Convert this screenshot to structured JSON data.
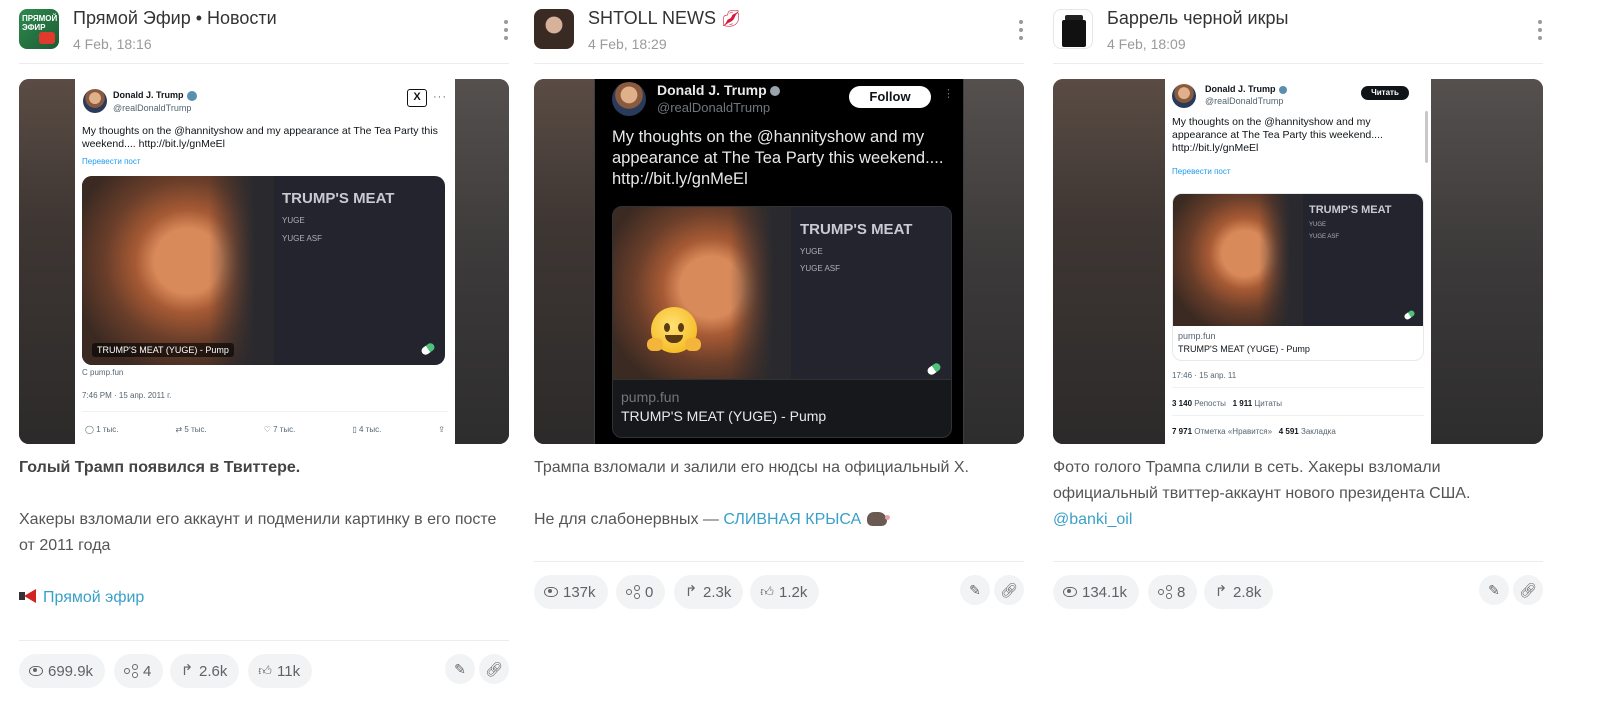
{
  "posts": [
    {
      "channel": "Прямой Эфир • Новости",
      "avatar_text": "ПРЯМОЙ ЭФИР",
      "date": "4 Feb, 18:16",
      "tweet": {
        "name": "Donald J. Trump",
        "handle": "@realDonaldTrump",
        "text": "My thoughts on the @hannityshow and my appearance at The Tea Party this weekend.... http://bit.ly/gnMeEl",
        "translate": "Перевести пост",
        "card_title": "TRUMP'S MEAT",
        "card_line1": "YUGE",
        "card_line2": "YUGE ASF",
        "image_caption": "TRUMP'S MEAT (YUGE) - Pump",
        "source": "С pump.fun",
        "timestamp": "7:46 PM · 15 апр. 2011 г.",
        "replies": "1 тыс.",
        "retweets": "5 тыс.",
        "likes": "7 тыс.",
        "bookmarks": "4 тыс."
      },
      "title": "Голый Трамп появился в Твиттере.",
      "body": "Хакеры взломали его аккаунт и подменили картинку в его посте от 2011 года",
      "signature": "Прямой эфир",
      "stats": {
        "views": "699.9k",
        "shares": "4",
        "forwards": "2.6k",
        "reactions": "11k"
      }
    },
    {
      "channel": "SHTOLL NEWS",
      "date": "4 Feb, 18:29",
      "tweet": {
        "name": "Donald J. Trump",
        "handle": "@realDonaldTrump",
        "follow": "Follow",
        "text": "My thoughts on the @hannityshow and my appearance at The Tea Party this weekend.... http://bit.ly/gnMeEl",
        "card_title": "TRUMP'S MEAT",
        "card_line1": "YUGE",
        "card_line2": "YUGE ASF",
        "link_domain": "pump.fun",
        "link_title": "TRUMP'S MEAT (YUGE) - Pump"
      },
      "body": "Трампа взломали и залили его нюдсы на официальный Х.",
      "footer_prefix": "Не для слабонервных — ",
      "footer_link": "СЛИВНАЯ КРЫСА",
      "stats": {
        "views": "137k",
        "shares": "0",
        "forwards": "2.3k",
        "reactions": "1.2k"
      }
    },
    {
      "channel": "Баррель черной икры",
      "date": "4 Feb, 18:09",
      "tweet": {
        "name": "Donald J. Trump",
        "handle": "@realDonaldTrump",
        "read": "Читать",
        "text": "My thoughts on the @hannityshow and my appearance at The Tea Party this weekend.... http://bit.ly/gnMeEl",
        "translate": "Перевести пост",
        "card_title": "TRUMP'S MEAT",
        "card_line1": "YUGE",
        "card_line2": "YUGE ASF",
        "link_domain": "pump.fun",
        "link_title": "TRUMP'S MEAT (YUGE) - Pump",
        "timestamp": "17:46 · 15 апр. 11",
        "reposts_num": "3 140",
        "reposts_label": "Репосты",
        "quotes_num": "1 911",
        "quotes_label": "Цитаты",
        "likes_num": "7 971",
        "likes_label": "Отметка «Нравится»",
        "bookmarks_num": "4 591",
        "bookmarks_label": "Закладка"
      },
      "body": "Фото голого Трампа слили в сеть. Хакеры взломали официальный твиттер-аккаунт нового президента США.",
      "mention": "@banki_oil",
      "stats": {
        "views": "134.1k",
        "shares": "8",
        "forwards": "2.8k"
      }
    }
  ]
}
